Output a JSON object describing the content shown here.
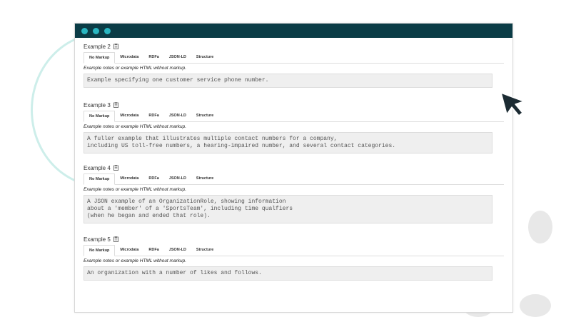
{
  "examples": [
    {
      "title": "Example 2",
      "tabs": [
        "No Markup",
        "Microdata",
        "RDFa",
        "JSON-LD",
        "Structure"
      ],
      "note": "Example notes or example HTML without markup.",
      "code": "Example specifying one customer service phone number."
    },
    {
      "title": "Example 3",
      "tabs": [
        "No Markup",
        "Microdata",
        "RDFa",
        "JSON-LD",
        "Structure"
      ],
      "note": "Example notes or example HTML without markup.",
      "code": "A fuller example that illustrates multiple contact numbers for a company,\nincluding US toll-free numbers, a hearing-impaired number, and several contact categories."
    },
    {
      "title": "Example 4",
      "tabs": [
        "No Markup",
        "Microdata",
        "RDFa",
        "JSON-LD",
        "Structure"
      ],
      "note": "Example notes or example HTML without markup.",
      "code": "A JSON example of an OrganizationRole, showing information\nabout a 'member' of a 'SportsTeam', including time qualfiers\n(when he began and ended that role)."
    },
    {
      "title": "Example 5",
      "tabs": [
        "No Markup",
        "Microdata",
        "RDFa",
        "JSON-LD",
        "Structure"
      ],
      "note": "Example notes or example HTML without markup.",
      "code": "An organization with a number of likes and follows."
    }
  ],
  "colors": {
    "titlebar": "#0b3c46",
    "dot": "#29b6c1",
    "code_bg": "#efefef"
  },
  "icons": [
    "clipboard-icon",
    "mouse-cursor-icon"
  ]
}
